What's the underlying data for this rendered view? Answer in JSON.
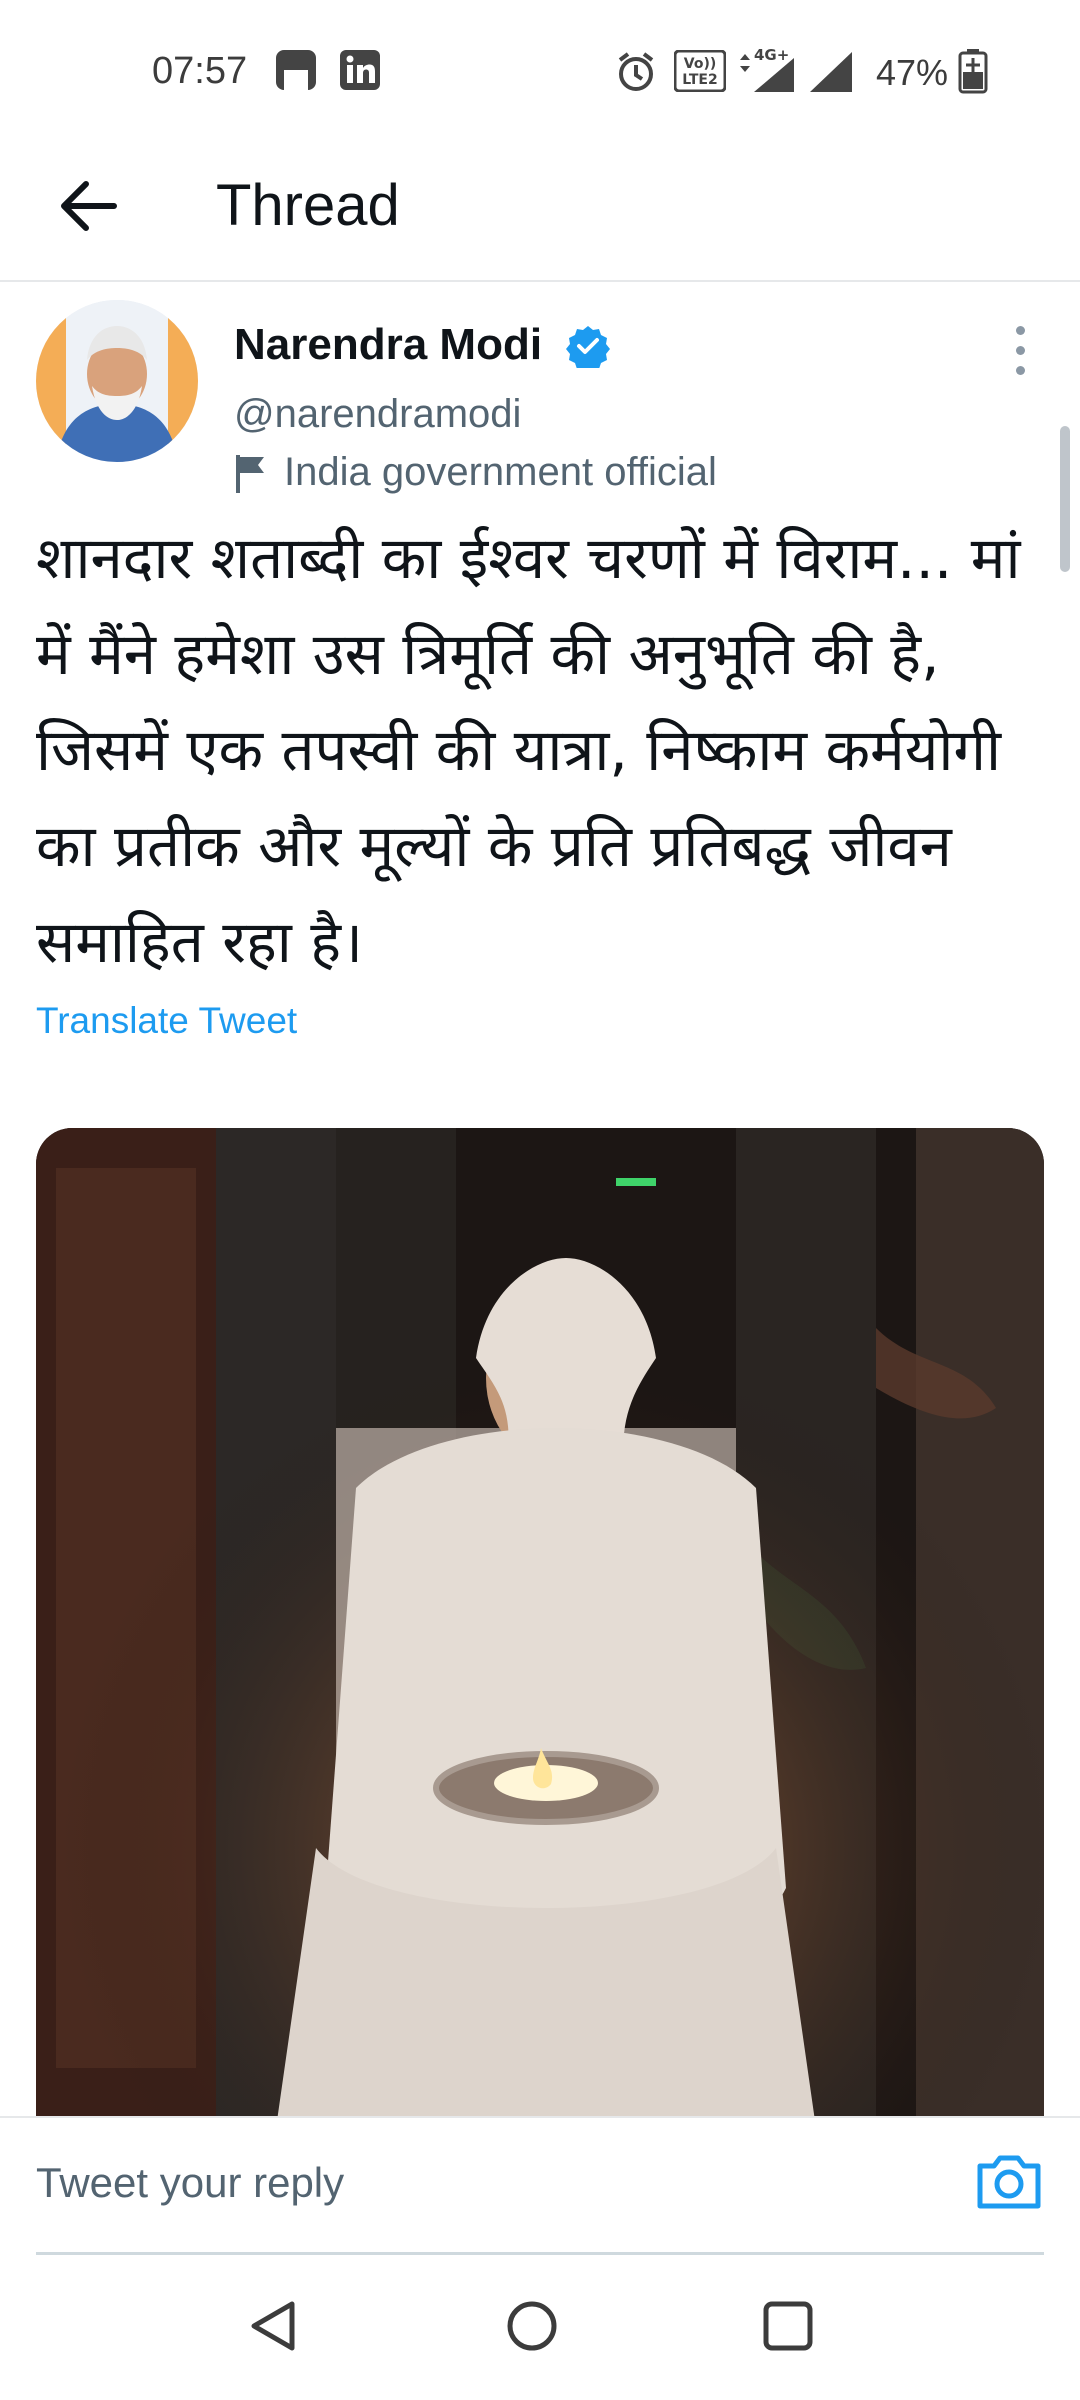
{
  "status_bar": {
    "time": "07:57",
    "battery_percent": "47%",
    "network_label": "4G+",
    "volte_label_1": "Vo))",
    "volte_label_2": "LTE2",
    "icons": [
      "save-icon",
      "linkedin-icon",
      "alarm-icon",
      "volte-icon",
      "data-arrows-icon",
      "signal-icon",
      "signal-icon",
      "battery-charging-icon"
    ]
  },
  "header": {
    "title": "Thread",
    "back_icon": "arrow-left-icon"
  },
  "tweet": {
    "author_name": "Narendra Modi",
    "handle": "@narendramodi",
    "label": "India government official",
    "text": "शानदार शताब्दी का ईश्वर चरणों में विराम... मां में मैंने हमेशा उस त्रिमूर्ति की अनुभूति की है, जिसमें एक तपस्वी की यात्रा, निष्काम कर्मयोगी का प्रतीक और मूल्यों के प्रति प्रतिबद्ध जीवन समाहित रहा है।",
    "translate_label": "Translate Tweet"
  },
  "reply": {
    "placeholder": "Tweet your reply",
    "camera_icon": "camera-icon"
  },
  "nav": {
    "icons": [
      "back-triangle-icon",
      "home-circle-icon",
      "recents-square-icon"
    ]
  },
  "colors": {
    "accent": "#1d9bf0",
    "text_primary": "#0f1419",
    "text_secondary": "#536471"
  }
}
